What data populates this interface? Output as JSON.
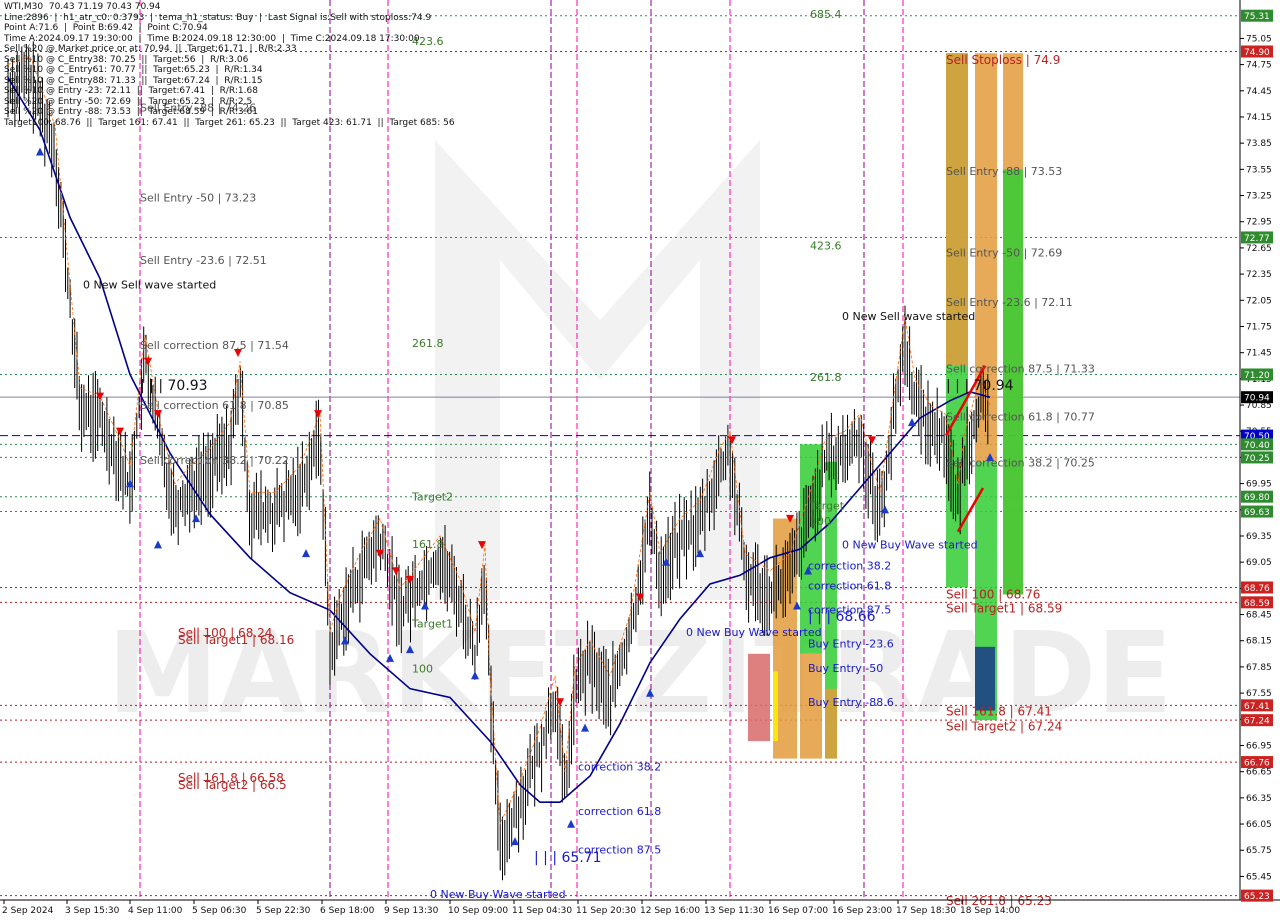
{
  "header": {
    "lines": [
      "WTI,M30  70.43 71.19 70.43 70.94",
      "Line:2896  |  h1_atr_c0: 0.3793  |  tema_h1_status: Buy  |  Last Signal is:Sell with stoploss:74.9",
      "Point A:71.6  |  Point B:69.42  |  Point C:70.94",
      "Time A:2024.09.17 19:30:00  |  Time B:2024.09.18 12:30:00  |  Time C:2024.09.18 17:30:00",
      "Sell %20 @ Market price or at: 70.94  ||  Target:61.71  |  R/R:2.33",
      "Sell %10 @ C_Entry38: 70.25  ||  Target:56  |  R/R:3.06",
      "Sell %10 @ C_Entry61: 70.77  ||  Target:65.23  |  R/R:1.34",
      "Sell %10 @ C_Entry88: 71.33  ||  Target:67.24  |  R/R:1.15",
      "Sell %10 @ Entry -23: 72.11  ||  Target:67.41  |  R/R:1.68",
      "Sell %20 @ Entry -50: 72.69  ||  Target:65.23  |  R/R:2.5",
      "Sell %20 @ Entry -88: 73.53  ||  Target:68.59  |  R/R:3.61",
      "Target100: 68.76  ||  Target 161: 67.41  ||  Target 261: 65.23  ||  Target 423: 61.71  ||  Target 685: 56"
    ]
  },
  "colors": {
    "candle": "#000000",
    "ma": "#00008b",
    "fractal": "#ff6600",
    "vline_pink": "#ff00aa",
    "vline_purple": "#8b008b",
    "green_level": "#2e8b57",
    "red_level": "#b22222",
    "blue_level": "#0000cd",
    "green_tag": "#2e8b2e",
    "red_tag": "#cc2222",
    "blue_tag": "#0000cd",
    "gray_tag": "#000000",
    "orange_bar": "#e39b3c",
    "green_bar": "#33cc33",
    "navy_bar": "#1a3a8a",
    "yellow_bar": "#ffee00"
  },
  "watermark": "MARKETZITRADE",
  "chart_data": {
    "type": "candlestick",
    "symbol": "WTI",
    "timeframe": "M30",
    "ylim": [
      65.18,
      75.49
    ],
    "y_ticks": [
      75.05,
      74.75,
      74.45,
      74.15,
      73.85,
      73.55,
      73.25,
      72.95,
      72.65,
      72.35,
      72.05,
      71.75,
      71.45,
      71.15,
      70.85,
      70.55,
      70.25,
      69.95,
      69.65,
      69.35,
      69.05,
      68.75,
      68.45,
      68.15,
      67.85,
      67.55,
      67.25,
      66.95,
      66.65,
      66.35,
      66.05,
      65.75,
      65.45
    ],
    "x_labels": [
      "2 Sep 2024",
      "3 Sep 15:30",
      "4 Sep 11:00",
      "5 Sep 06:30",
      "5 Sep 22:30",
      "6 Sep 18:00",
      "9 Sep 13:30",
      "10 Sep 09:00",
      "11 Sep 04:30",
      "11 Sep 20:30",
      "12 Sep 16:00",
      "13 Sep 11:30",
      "16 Sep 07:00",
      "16 Sep 23:00",
      "17 Sep 18:30",
      "18 Sep 14:00"
    ],
    "last_price": 70.94,
    "level_tags": [
      {
        "value": 75.31,
        "label": "75.31",
        "kind": "green"
      },
      {
        "value": 74.9,
        "label": "74.90",
        "kind": "red"
      },
      {
        "value": 72.77,
        "label": "72.77",
        "kind": "green"
      },
      {
        "value": 71.2,
        "label": "71.20",
        "kind": "green"
      },
      {
        "value": 70.94,
        "label": "70.94",
        "kind": "gray"
      },
      {
        "value": 70.5,
        "label": "70.50",
        "kind": "blue"
      },
      {
        "value": 70.4,
        "label": "70.40",
        "kind": "green"
      },
      {
        "value": 70.25,
        "label": "70.25",
        "kind": "green"
      },
      {
        "value": 69.8,
        "label": "69.80",
        "kind": "green"
      },
      {
        "value": 69.63,
        "label": "69.63",
        "kind": "green"
      },
      {
        "value": 68.76,
        "label": "68.76",
        "kind": "red"
      },
      {
        "value": 68.59,
        "label": "68.59",
        "kind": "red"
      },
      {
        "value": 67.41,
        "label": "67.41",
        "kind": "red"
      },
      {
        "value": 67.24,
        "label": "67.24",
        "kind": "red"
      },
      {
        "value": 66.76,
        "label": "66.76",
        "kind": "red"
      },
      {
        "value": 65.23,
        "label": "65.23",
        "kind": "red"
      }
    ],
    "annotations": [
      {
        "text": "423.6",
        "x": "10 Sep 09:00",
        "y": 75.02,
        "kind": "green"
      },
      {
        "text": "685.4",
        "x": "16 Sep 23:00",
        "y": 75.33,
        "kind": "green"
      },
      {
        "text": "423.6",
        "x": "16 Sep 23:00",
        "y": 72.68,
        "kind": "green"
      },
      {
        "text": "261.8",
        "x": "10 Sep 09:00",
        "y": 71.56,
        "kind": "green"
      },
      {
        "text": "261.8",
        "x": "16 Sep 23:00",
        "y": 71.17,
        "kind": "green"
      },
      {
        "text": "Target2",
        "x": "10 Sep 09:00",
        "y": 69.8,
        "kind": "green"
      },
      {
        "text": "161.8",
        "x": "10 Sep 09:00",
        "y": 69.26,
        "kind": "green"
      },
      {
        "text": "Target1",
        "x": "10 Sep 09:00",
        "y": 68.35,
        "kind": "green"
      },
      {
        "text": "100",
        "x": "10 Sep 09:00",
        "y": 67.83,
        "kind": "green"
      },
      {
        "text": "Target",
        "x": "16 Sep 23:00",
        "y": 69.7,
        "kind": "green"
      },
      {
        "text": "100",
        "x": "16 Sep 23:00",
        "y": 69.52,
        "kind": "green"
      },
      {
        "text": "Sell Entry -88 | 74.26",
        "x": "4 Sep 11:00",
        "y": 74.26,
        "kind": "gray"
      },
      {
        "text": "Sell Entry -50 | 73.23",
        "x": "4 Sep 11:00",
        "y": 73.23,
        "kind": "gray"
      },
      {
        "text": "Sell Entry -23.6 | 72.51",
        "x": "4 Sep 11:00",
        "y": 72.51,
        "kind": "gray"
      },
      {
        "text": "0 New Sell wave started",
        "x": "3 Sep 15:30",
        "y": 72.23,
        "kind": "black"
      },
      {
        "text": "Sell correction 87.5 | 71.54",
        "x": "4 Sep 11:00",
        "y": 71.54,
        "kind": "gray"
      },
      {
        "text": "| | | 70.93",
        "x": "4 Sep 11:00",
        "y": 71.07,
        "kind": "black"
      },
      {
        "text": "Sell correction 61.8 | 70.85",
        "x": "4 Sep 11:00",
        "y": 70.85,
        "kind": "gray"
      },
      {
        "text": "Sell correction 38.2 | 70.22",
        "x": "4 Sep 11:00",
        "y": 70.22,
        "kind": "gray"
      },
      {
        "text": "Sell 100 | 68.24",
        "x": "5 Sep 06:30",
        "y": 68.24,
        "kind": "red"
      },
      {
        "text": "Sell Target1 | 68.16",
        "x": "5 Sep 06:30",
        "y": 68.16,
        "kind": "red"
      },
      {
        "text": "Sell 161.8 | 66.58",
        "x": "5 Sep 06:30",
        "y": 66.58,
        "kind": "red"
      },
      {
        "text": "Sell Target2 | 66.5",
        "x": "5 Sep 06:30",
        "y": 66.5,
        "kind": "red"
      },
      {
        "text": "correction 38.2",
        "x": "11 Sep 20:30",
        "y": 66.71,
        "kind": "blue"
      },
      {
        "text": "correction 61.8",
        "x": "11 Sep 20:30",
        "y": 66.2,
        "kind": "blue"
      },
      {
        "text": "correction 87.5",
        "x": "11 Sep 20:30",
        "y": 65.76,
        "kind": "blue"
      },
      {
        "text": "| | | 65.71",
        "x": "11 Sep 04:30",
        "y": 65.66,
        "kind": "blue"
      },
      {
        "text": "0 New Buy Wave started",
        "x": "9 Sep 13:30",
        "y": 65.25,
        "kind": "blue"
      },
      {
        "text": "0 New Buy Wave started",
        "x": "13 Sep 11:30",
        "y": 68.25,
        "kind": "blue"
      },
      {
        "text": "| | | 68.66",
        "x": "16 Sep 07:00",
        "y": 68.42,
        "kind": "blue"
      },
      {
        "text": "correction 38.2",
        "x": "16 Sep 07:00",
        "y": 69.01,
        "kind": "blue"
      },
      {
        "text": "correction 61.8",
        "x": "16 Sep 07:00",
        "y": 68.78,
        "kind": "blue"
      },
      {
        "text": "correction 87.5",
        "x": "16 Sep 07:00",
        "y": 68.51,
        "kind": "blue"
      },
      {
        "text": "Buy Entry -23.6",
        "x": "16 Sep 07:00",
        "y": 68.12,
        "kind": "blue"
      },
      {
        "text": "Buy Entry -50",
        "x": "16 Sep 07:00",
        "y": 67.84,
        "kind": "blue"
      },
      {
        "text": "Buy Entry -88.6",
        "x": "16 Sep 07:00",
        "y": 67.45,
        "kind": "blue"
      },
      {
        "text": "0 New Sell wave started",
        "x": "17 Sep 18:30",
        "y": 71.87,
        "kind": "black"
      },
      {
        "text": "0 New Buy Wave started",
        "x": "17 Sep 18:30",
        "y": 69.25,
        "kind": "blue"
      },
      {
        "text": "Sell Stoploss | 74.9",
        "x": "18 Sep 14:00",
        "y": 74.8,
        "kind": "red"
      },
      {
        "text": "Sell Entry -88 | 73.53",
        "x": "18 Sep 14:00",
        "y": 73.53,
        "kind": "gray"
      },
      {
        "text": "Sell Entry -50 | 72.69",
        "x": "18 Sep 14:00",
        "y": 72.6,
        "kind": "gray"
      },
      {
        "text": "Sell Entry -23.6 | 72.11",
        "x": "18 Sep 14:00",
        "y": 72.03,
        "kind": "gray"
      },
      {
        "text": "Sell correction 87.5 | 71.33",
        "x": "18 Sep 14:00",
        "y": 71.27,
        "kind": "gray"
      },
      {
        "text": "| | | 70.94",
        "x": "18 Sep 14:00",
        "y": 71.07,
        "kind": "black"
      },
      {
        "text": "Sell correction 61.8 | 70.77",
        "x": "18 Sep 14:00",
        "y": 70.72,
        "kind": "gray"
      },
      {
        "text": "Sell correction 38.2 | 70.25",
        "x": "18 Sep 14:00",
        "y": 70.19,
        "kind": "gray"
      },
      {
        "text": "Sell 100 | 68.76",
        "x": "18 Sep 14:00",
        "y": 68.68,
        "kind": "red"
      },
      {
        "text": "Sell Target1 | 68.59",
        "x": "18 Sep 14:00",
        "y": 68.52,
        "kind": "red"
      },
      {
        "text": "Sell 161.8 | 67.41",
        "x": "18 Sep 14:00",
        "y": 67.34,
        "kind": "red"
      },
      {
        "text": "Sell Target2 | 67.24",
        "x": "18 Sep 14:00",
        "y": 67.17,
        "kind": "red"
      },
      {
        "text": "Sell 261.8 | 65.23",
        "x": "18 Sep 14:00",
        "y": 65.17,
        "kind": "red"
      }
    ]
  }
}
